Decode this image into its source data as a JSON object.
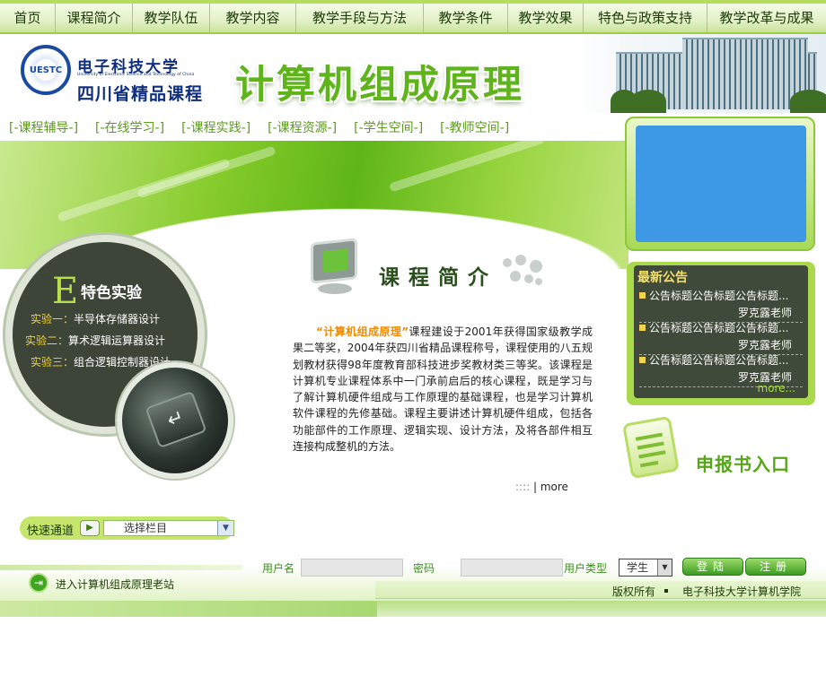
{
  "nav": {
    "items": [
      "首页",
      "课程简介",
      "教学队伍",
      "教学内容",
      "教学手段与方法",
      "教学条件",
      "教学效果",
      "特色与政策支持",
      "教学改革与成果"
    ]
  },
  "header": {
    "logo_abbr": "UESTC",
    "university_cn": "电子科技大学",
    "university_en": "University of Electronic Science and Technology of China",
    "province_course": "四川省精品课程",
    "course_title": "计算机组成原理"
  },
  "subnav": [
    "[-课程辅导-]",
    "[-在线学习-]",
    "[-课程实践-]",
    "[-课程资源-]",
    "[-学生空间-]",
    "[-教师空间-]"
  ],
  "features": {
    "letter": "E",
    "title": "特色实验",
    "items": [
      {
        "label": "实验一：",
        "name": "半导体存储器设计"
      },
      {
        "label": "实验二：",
        "name": "算术逻辑运算器设计"
      },
      {
        "label": "实验三：",
        "name": "组合逻辑控制器设计"
      }
    ]
  },
  "intro": {
    "title": "课程简介",
    "highlight": "“计算机组成原理”",
    "body": "课程建设于2001年获得国家级教学成果二等奖，2004年获四川省精品课程称号，课程使用的八五规划教材获得98年度教育部科技进步奖教材类三等奖。该课程是计算机专业课程体系中一门承前启后的核心课程，既是学习与了解计算机硬件组成与工作原理的基础课程，也是学习计算机软件课程的先修基础。课程主要讲述计算机硬件组成，包括各功能部件的工作原理、逻辑实现、设计方法，及将各部件相互连接构成整机的方法。",
    "more_prefix": "::::",
    "more": "more"
  },
  "notice": {
    "title": "最新公告",
    "items": [
      {
        "title": "公告标题公告标题公告标题...",
        "author": "罗克露老师"
      },
      {
        "title": "公告标题公告标题公告标题...",
        "author": "罗克露老师"
      },
      {
        "title": "公告标题公告标题公告标题...",
        "author": "罗克露老师"
      }
    ],
    "more": "more..."
  },
  "report": {
    "label": "申报书入口"
  },
  "quick": {
    "label": "快速通道",
    "select_value": "选择栏目"
  },
  "login": {
    "username_label": "用户名",
    "password_label": "密码",
    "usertype_label": "用户类型",
    "usertype_value": "学生",
    "login_button": "登陆",
    "register_button": "注册"
  },
  "footer": {
    "oldsite": "进入计算机组成原理老站",
    "copyright": "版权所有",
    "org": "电子科技大学计算机学院"
  },
  "colors": {
    "accent": "#5fb41b",
    "nav_text": "#1b3a06",
    "screen_blue": "#3d99e6",
    "highlight": "#f08a00"
  }
}
